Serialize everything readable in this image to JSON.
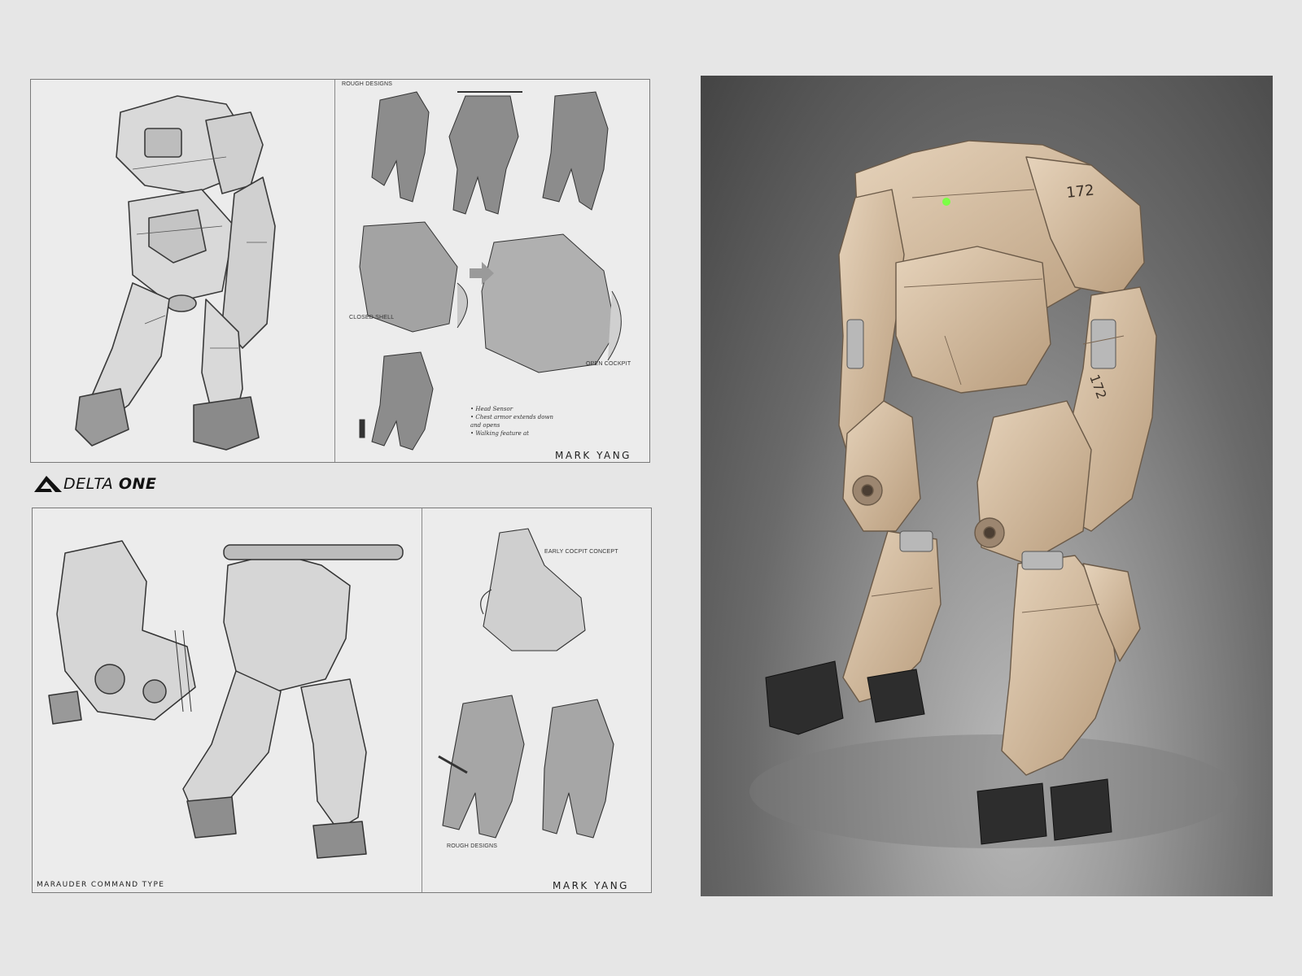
{
  "brand": {
    "word1": "DELTA",
    "word2": "ONE"
  },
  "top_sheet": {
    "rough_label": "ROUGH DESIGNS",
    "closed_label": "CLOSED SHELL",
    "open_label": "OPEN COCKPIT",
    "notes": [
      "• Head Sensor",
      "• Chest armor extends down",
      "  and opens",
      "• Walking feature at"
    ],
    "artist": "MARK YANG"
  },
  "bottom_sheet": {
    "type_caption": "MARAUDER COMMAND TYPE",
    "cockpit_label": "EARLY COCPIT CONCEPT",
    "rough_label": "ROUGH DESIGNS",
    "artist": "MARK YANG"
  },
  "render": {
    "hull_number": "172",
    "hull_color": "#d8c1a4",
    "background": "#555555"
  }
}
